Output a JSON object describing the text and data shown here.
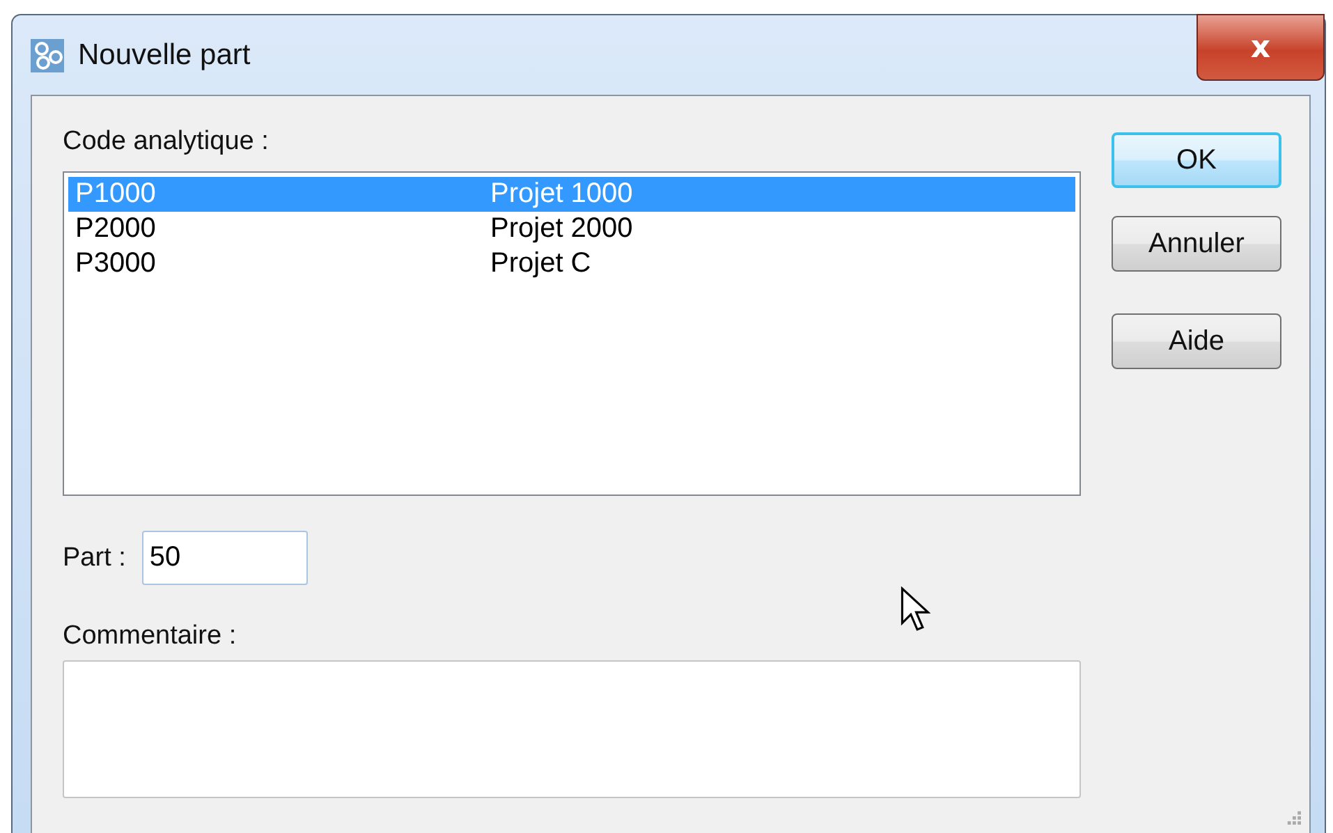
{
  "window": {
    "title": "Nouvelle part",
    "close_label": "x"
  },
  "code_analytique": {
    "label": "Code analytique :",
    "rows": [
      {
        "code": "P1000",
        "name": "Projet 1000",
        "selected": true
      },
      {
        "code": "P2000",
        "name": "Projet 2000",
        "selected": false
      },
      {
        "code": "P3000",
        "name": "Projet C",
        "selected": false
      }
    ]
  },
  "part": {
    "label": "Part :",
    "value": "50"
  },
  "commentaire": {
    "label": "Commentaire :"
  },
  "buttons": [
    {
      "label": "OK",
      "default": true
    },
    {
      "label": "Annuler",
      "default": false
    },
    {
      "label": "Aide",
      "default": false
    }
  ]
}
